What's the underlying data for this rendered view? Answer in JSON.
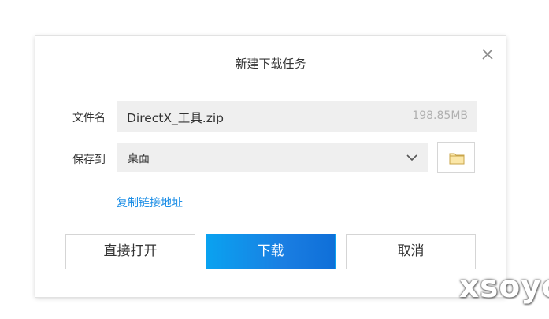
{
  "dialog": {
    "title": "新建下载任务",
    "close_icon": "close-icon"
  },
  "file": {
    "label": "文件名",
    "name": "DirectX_工具.zip",
    "size": "198.85MB"
  },
  "save": {
    "label": "保存到",
    "selected": "桌面",
    "dropdown_icon": "chevron-down-icon",
    "folder_icon": "folder-icon"
  },
  "copy_link_label": "复制链接地址",
  "buttons": {
    "open": "直接打开",
    "download": "下载",
    "cancel": "取消"
  },
  "colors": {
    "accent": "#1a7ee2",
    "link": "#1c8ee6",
    "folder": "#f5d98a"
  },
  "watermark": "xsoyo"
}
